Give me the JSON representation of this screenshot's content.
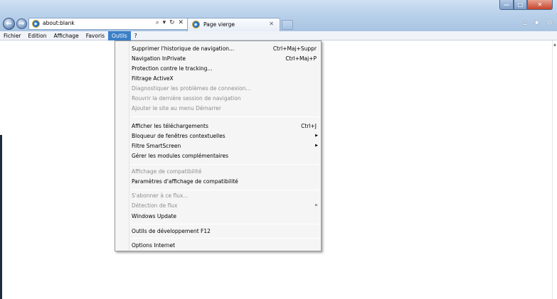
{
  "browser": {
    "address": "about:blank",
    "address_tools": "⌕ ▾ ↻ ✕",
    "tab_title": "Page vierge",
    "tab_close": "✕",
    "window_buttons": {
      "minimize": "—",
      "maximize": "□",
      "close": "✕"
    },
    "right_icons": {
      "home": "⌂",
      "favorites": "★",
      "tools": "⚙"
    }
  },
  "menubar": {
    "items": [
      "Fichier",
      "Edition",
      "Affichage",
      "Favoris",
      "Outils",
      "?"
    ],
    "active": "Outils"
  },
  "dropdown": {
    "items": [
      {
        "label": "Supprimer l'historique de navigation...",
        "shortcut": "Ctrl+Maj+Suppr",
        "disabled": false
      },
      {
        "label": "Navigation InPrivate",
        "shortcut": "Ctrl+Maj+P",
        "disabled": false
      },
      {
        "label": "Protection contre le tracking...",
        "disabled": false
      },
      {
        "label": "Filtrage ActiveX",
        "disabled": false
      },
      {
        "label": "Diagnostiquer les problèmes de connexion...",
        "disabled": true
      },
      {
        "label": "Rouvrir la dernière session de navigation",
        "disabled": true
      },
      {
        "label": "Ajouter le site au menu Démarrer",
        "disabled": true
      },
      {
        "label": "Afficher les téléchargements",
        "shortcut": "Ctrl+J",
        "disabled": false
      },
      {
        "label": "Bloqueur de fenêtres contextuelles",
        "submenu": true,
        "disabled": false
      },
      {
        "label": "Filtre SmartScreen",
        "submenu": true,
        "disabled": false
      },
      {
        "label": "Gérer les modules complémentaires",
        "disabled": false
      },
      {
        "label": "Affichage de compatibilité",
        "disabled": true
      },
      {
        "label": "Paramètres d'affichage de compatibilité",
        "disabled": false
      },
      {
        "label": "S'abonner à ce flux...",
        "disabled": true
      },
      {
        "label": "Détection de flux",
        "submenu": true,
        "disabled": true
      },
      {
        "label": "Windows Update",
        "disabled": false
      },
      {
        "label": "Outils de développement F12",
        "disabled": false
      },
      {
        "label": "Options Internet",
        "disabled": false
      }
    ]
  }
}
